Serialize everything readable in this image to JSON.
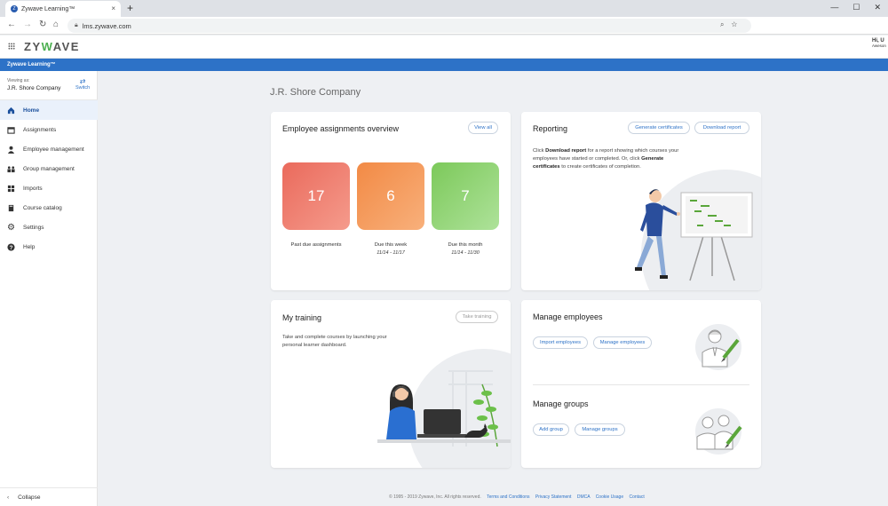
{
  "browser": {
    "tab_title": "Zywave Learning™",
    "tab_close": "×",
    "new_tab": "+",
    "url": "lms.zywave.com"
  },
  "app": {
    "logo_prefix": "ZY",
    "logo_accent": "W",
    "logo_suffix": "AVE",
    "banner": "Zywave Learning™",
    "user_greeting": "Hi, U",
    "user_sub": "Aweson"
  },
  "sidebar": {
    "viewing_as_label": "Viewing as:",
    "company": "J.R. Shore Company",
    "switch_label": "Switch",
    "items": [
      {
        "label": "Home",
        "icon": "home-icon"
      },
      {
        "label": "Assignments",
        "icon": "calendar-icon"
      },
      {
        "label": "Employee management",
        "icon": "person-icon"
      },
      {
        "label": "Group management",
        "icon": "group-icon"
      },
      {
        "label": "Imports",
        "icon": "grid-icon"
      },
      {
        "label": "Course catalog",
        "icon": "book-icon"
      },
      {
        "label": "Settings",
        "icon": "gear-icon"
      },
      {
        "label": "Help",
        "icon": "help-icon"
      }
    ],
    "collapse_label": "Collapse"
  },
  "main": {
    "page_title": "J.R. Shore Company",
    "assignments": {
      "title": "Employee assignments overview",
      "view_all": "View all",
      "stats": [
        {
          "value": "17",
          "label": "Past due assignments",
          "date": ""
        },
        {
          "value": "6",
          "label": "Due this week",
          "date": "11/14 - 11/17"
        },
        {
          "value": "7",
          "label": "Due this month",
          "date": "11/14 - 11/30"
        }
      ]
    },
    "reporting": {
      "title": "Reporting",
      "generate_certificates": "Generate certificates",
      "download_report": "Download report",
      "text_1": "Click ",
      "text_bold_1": "Download report",
      "text_2": " for a report showing which courses your employees have started or completed. Or, click ",
      "text_bold_2": "Generate certificates",
      "text_3": " to create certificates of completion."
    },
    "training": {
      "title": "My training",
      "take_training": "Take training",
      "text": "Take and complete courses by launching your personal learner dashboard."
    },
    "manage_employees": {
      "title": "Manage employees",
      "import_btn": "Import employees",
      "manage_btn": "Manage employees"
    },
    "manage_groups": {
      "title": "Manage groups",
      "add_btn": "Add group",
      "manage_btn": "Manage groups"
    }
  },
  "footer": {
    "copyright": "© 1995 - 2019 Zywave, Inc. All rights reserved.",
    "links": [
      "Terms and Conditions",
      "Privacy Statement",
      "DMCA",
      "Cookie Usage",
      "Contact"
    ]
  },
  "colors": {
    "accent": "#2d72c7",
    "past_due": "#ef7d6e",
    "due_week": "#f59a5b",
    "due_month": "#8fd06f"
  }
}
